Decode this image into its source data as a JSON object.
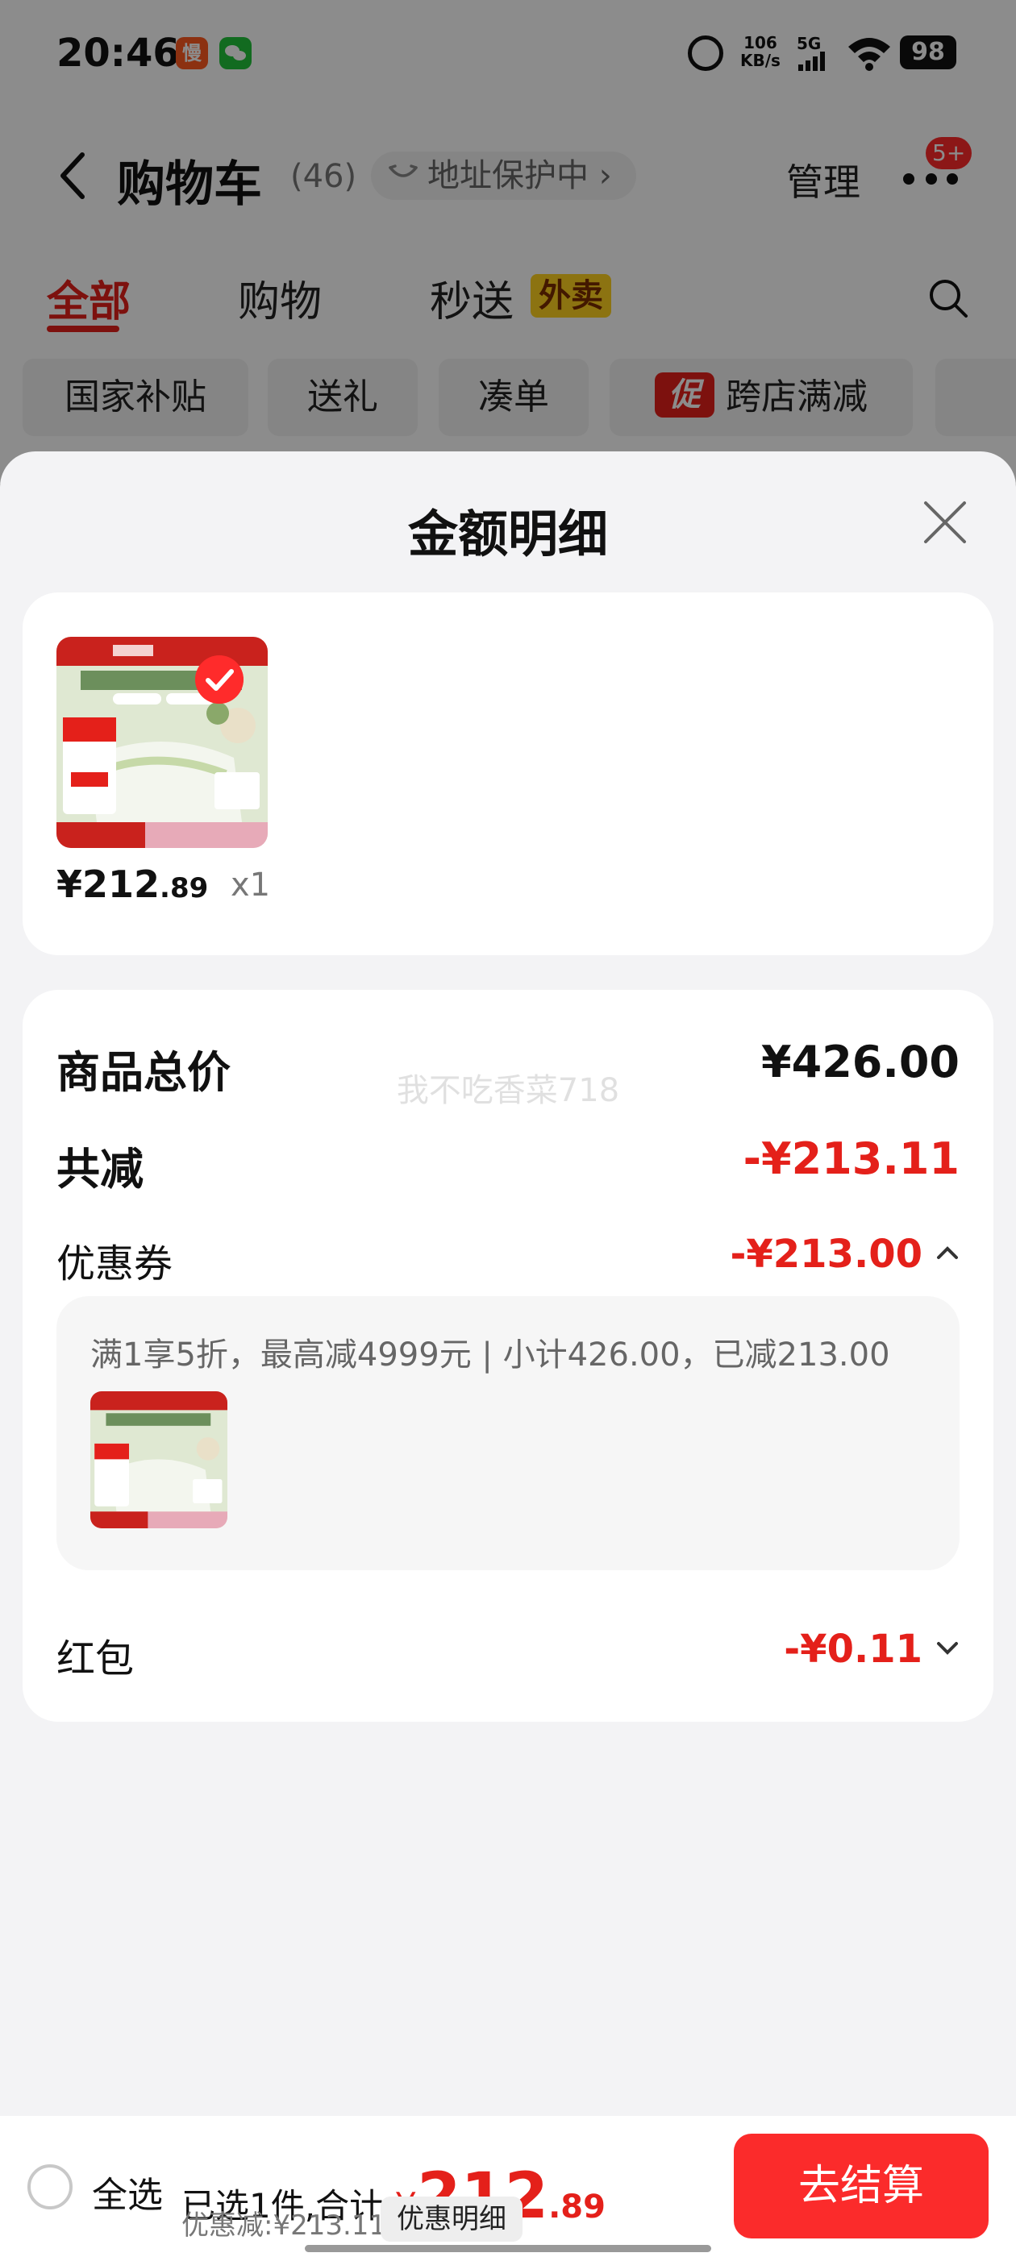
{
  "status_bar": {
    "time": "20:46",
    "app_icon_1": "慢",
    "net_speed_value": "106",
    "net_speed_unit": "KB/s",
    "network_type": "5G",
    "battery": "98"
  },
  "cart_header": {
    "title": "购物车",
    "count": "(46)",
    "address_protection": "地址保护中 ›",
    "manage_label": "管理",
    "more_badge": "5+"
  },
  "tabs": [
    {
      "label": "全部",
      "active": true
    },
    {
      "label": "购物",
      "active": false
    },
    {
      "label": "秒送",
      "active": false,
      "tag": "外卖"
    }
  ],
  "chips": [
    {
      "label": "国家补贴"
    },
    {
      "label": "送礼"
    },
    {
      "label": "凑单"
    },
    {
      "label": "跨店满减",
      "badge": "促"
    }
  ],
  "sheet": {
    "title": "金额明细",
    "item": {
      "price_int": "¥212",
      "price_dec": ".89",
      "quantity": "x1"
    },
    "summary": {
      "total_label": "商品总价",
      "total_value": "¥426.00",
      "reduce_label": "共减",
      "reduce_value": "-¥213.11",
      "coupon_label": "优惠券",
      "coupon_value": "-¥213.00",
      "coupon_detail": "满1享5折，最高减4999元 | 小计426.00，已减213.00",
      "redpack_label": "红包",
      "redpack_value": "-¥0.11",
      "watermark": "我不吃香菜718"
    }
  },
  "action_bar": {
    "select_all": "全选",
    "selected_text": "已选1件,合计:",
    "total_sym": "¥",
    "total_int": "212",
    "total_dec": ".89",
    "discount_text": "优惠减:¥213.11",
    "detail_label": "优惠明细",
    "checkout_label": "去结算"
  },
  "colors": {
    "accent_red": "#e4201a",
    "checkout_red": "#fb2b2b",
    "tag_yellow": "#ffd21f"
  },
  "icons": [
    "back-icon",
    "shield-icon",
    "more-icon",
    "search-icon",
    "close-icon",
    "check-icon",
    "chevron-up-icon",
    "chevron-down-icon",
    "alarm-icon",
    "wifi-icon",
    "signal-icon",
    "battery-icon"
  ]
}
